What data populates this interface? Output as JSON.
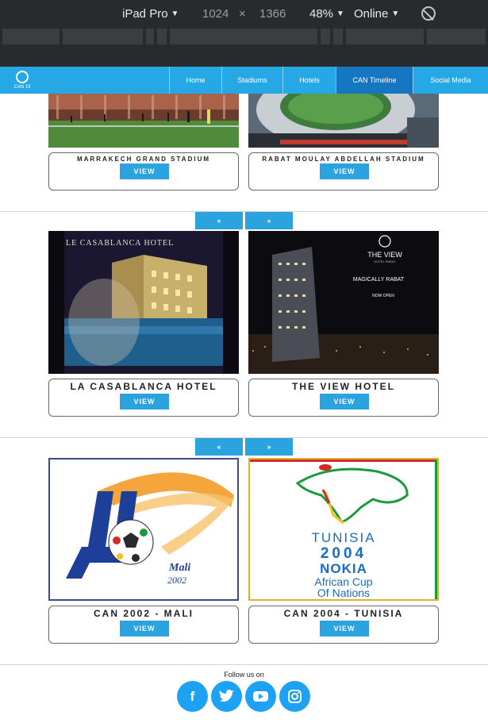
{
  "devtools": {
    "device": "iPad Pro",
    "width": "1024",
    "times": "×",
    "height": "1366",
    "zoom": "48%",
    "network": "Online"
  },
  "nav": {
    "logo_text": "CAN 19",
    "items": [
      {
        "label": "Home"
      },
      {
        "label": "Stadiums"
      },
      {
        "label": "Hotels"
      },
      {
        "label": "CAN Timeline",
        "active": true
      },
      {
        "label": "Social Media"
      }
    ]
  },
  "sections": {
    "stadiums": [
      {
        "title": "MARRAKECH GRAND STADIUM",
        "button": "VIEW"
      },
      {
        "title": "RABAT MOULAY ABDELLAH STADIUM",
        "button": "VIEW"
      }
    ],
    "hotels": [
      {
        "title": "LA CASABLANCA HOTEL",
        "button": "VIEW",
        "image_text": "LE CASABLANCA HOTEL"
      },
      {
        "title": "THE VIEW HOTEL",
        "button": "VIEW",
        "image_text_1": "THE VIEW",
        "image_text_2": "HOTEL RABAT",
        "image_text_3": "MAGICALLY RABAT",
        "image_text_4": "NOW OPEN"
      }
    ],
    "timeline": [
      {
        "title": "CAN 2002 - MALI",
        "button": "VIEW",
        "logo_text_1": "Mali",
        "logo_text_2": "2002"
      },
      {
        "title": "CAN 2004 - TUNISIA",
        "button": "VIEW",
        "logo_text_1": "TUNISIA",
        "logo_text_2": "2004",
        "logo_text_3": "NOKIA",
        "logo_text_4": "African Cup",
        "logo_text_5": "Of  Nations"
      }
    ]
  },
  "pager": {
    "prev": "«",
    "next": "»"
  },
  "footer": {
    "follow": "Follow us on",
    "icons": [
      "facebook-icon",
      "twitter-icon",
      "youtube-icon",
      "instagram-icon"
    ]
  },
  "colors": {
    "nav": "#27a8e6",
    "nav_active": "#1577c2",
    "button": "#2aa3de",
    "devtools": "#292a2d"
  }
}
